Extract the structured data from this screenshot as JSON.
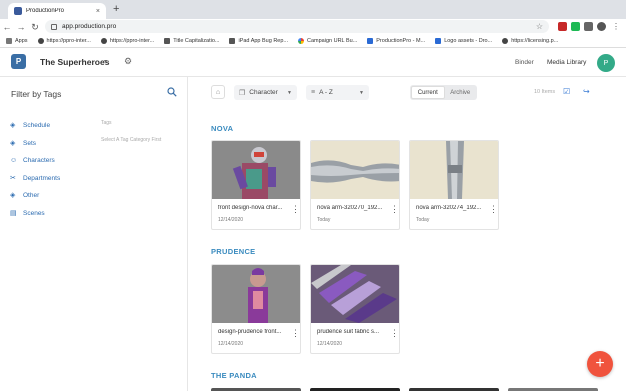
{
  "browser": {
    "tab_title": "ProductionPro",
    "tab_close": "×",
    "new_tab": "+",
    "url": "app.production.pro",
    "bookmarks": [
      {
        "label": "Apps",
        "icon": "grid-icon"
      },
      {
        "label": "https://ppro-inter...",
        "icon": "globe-icon"
      },
      {
        "label": "https://ppro-inter...",
        "icon": "globe-icon"
      },
      {
        "label": "Title Capitalizatio...",
        "icon": "page-icon"
      },
      {
        "label": "iPad App Bug Rep...",
        "icon": "apple-icon"
      },
      {
        "label": "Campaign URL Bu...",
        "icon": "google-icon"
      },
      {
        "label": "ProductionPro - M...",
        "icon": "dropbox-icon"
      },
      {
        "label": "Logo assets - Dro...",
        "icon": "dropbox-icon"
      },
      {
        "label": "https://licensing.p...",
        "icon": "globe-icon"
      }
    ]
  },
  "header": {
    "logo_glyph": "P",
    "project_name": "The Superheroes",
    "links": {
      "binder": "Binder",
      "media_library": "Media Library"
    },
    "avatar_initial": "P"
  },
  "sidebar": {
    "title": "Filter by Tags",
    "items": [
      {
        "label": "Schedule",
        "icon": "tag-icon"
      },
      {
        "label": "Sets",
        "icon": "tag-icon"
      },
      {
        "label": "Characters",
        "icon": "person-icon"
      },
      {
        "label": "Departments",
        "icon": "tools-icon"
      },
      {
        "label": "Other",
        "icon": "tag-icon"
      },
      {
        "label": "Scenes",
        "icon": "scenes-icon"
      }
    ],
    "tags_label": "Tags",
    "tags_hint": "Select A Tag Category First"
  },
  "toolbar": {
    "group_by": "Character",
    "sort_by": "A - Z",
    "segments": [
      "Current",
      "Archive"
    ],
    "items_count": "10 Items"
  },
  "sections": [
    {
      "title": "NOVA",
      "cards": [
        {
          "name": "front design-nova char...",
          "date": "12/14/2020"
        },
        {
          "name": "nova arm-320270_192...",
          "date": "Today"
        },
        {
          "name": "nova arm-320274_192...",
          "date": "Today"
        }
      ]
    },
    {
      "title": "PRUDENCE",
      "cards": [
        {
          "name": "design-prudence front...",
          "date": "12/14/2020"
        },
        {
          "name": "prudence suit fabric s...",
          "date": "12/14/2020"
        }
      ]
    },
    {
      "title": "THE PANDA",
      "cards": []
    }
  ],
  "fab_label": "+",
  "colors": {
    "accent": "#3a8bbf",
    "link": "#2b6bb0",
    "fab": "#f0533d",
    "avatar": "#33aa88"
  }
}
